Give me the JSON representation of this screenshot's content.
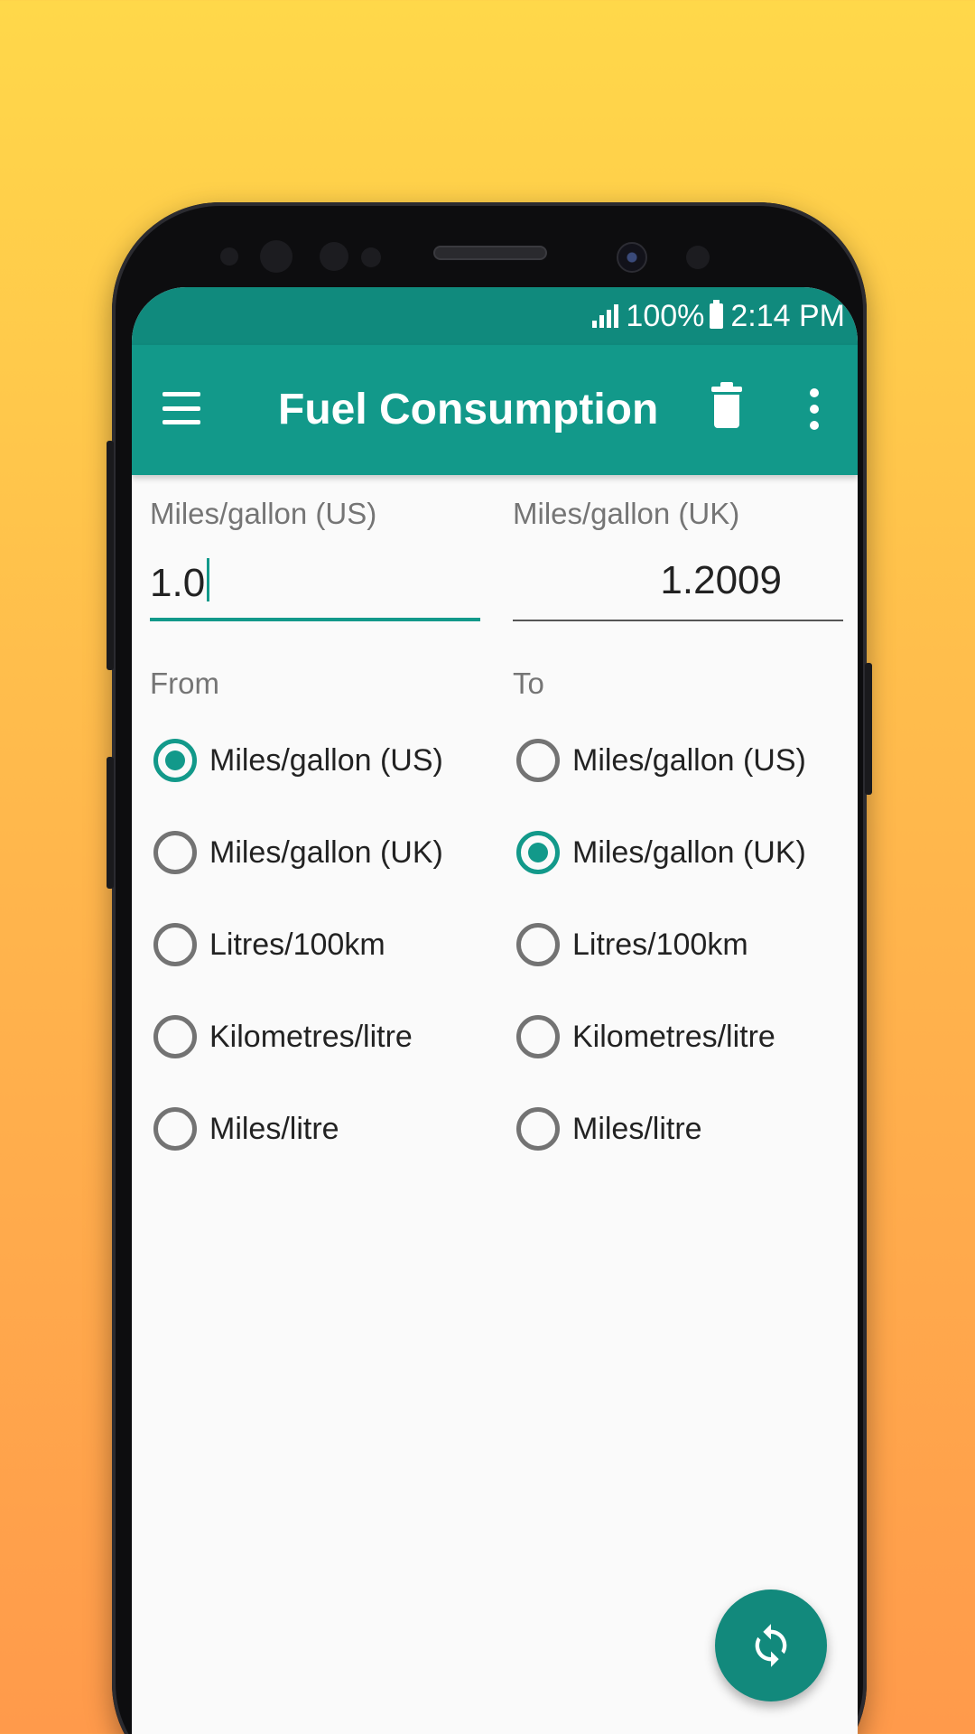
{
  "status_bar": {
    "battery": "100%",
    "time": "2:14 PM"
  },
  "app_bar": {
    "title": "Fuel Consumption"
  },
  "conversion": {
    "from_label": "Miles/gallon (US)",
    "from_value": "1.0",
    "to_label": "Miles/gallon (UK)",
    "to_value": "1.2009"
  },
  "from_section": {
    "label": "From",
    "options": [
      "Miles/gallon (US)",
      "Miles/gallon (UK)",
      "Litres/100km",
      "Kilometres/litre",
      "Miles/litre"
    ],
    "selected": "Miles/gallon (US)"
  },
  "to_section": {
    "label": "To",
    "options": [
      "Miles/gallon (US)",
      "Miles/gallon (UK)",
      "Litres/100km",
      "Kilometres/litre",
      "Miles/litre"
    ],
    "selected": "Miles/gallon (UK)"
  },
  "colors": {
    "primary": "#12998a",
    "status_bar": "#108a7d",
    "fab": "#12897c"
  },
  "icons": [
    "signal-icon",
    "battery-icon",
    "menu-icon",
    "trash-icon",
    "overflow-menu-icon",
    "swap-refresh-icon"
  ]
}
